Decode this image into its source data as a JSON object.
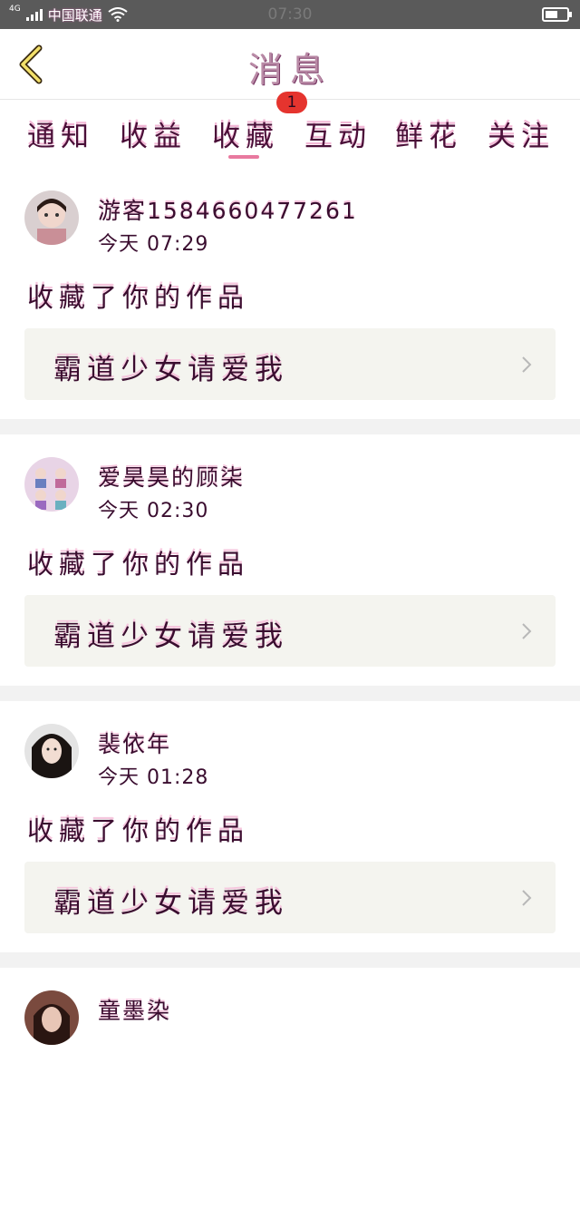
{
  "status_bar": {
    "network": "4G",
    "carrier": "中国联通",
    "time": "07:30",
    "battery_level": 0.6
  },
  "header": {
    "title": "消息"
  },
  "tabs": [
    {
      "label": "通知"
    },
    {
      "label": "收益"
    },
    {
      "label": "收藏",
      "active": true,
      "badge": "1"
    },
    {
      "label": "互动"
    },
    {
      "label": "鲜花"
    },
    {
      "label": "关注"
    }
  ],
  "feed": [
    {
      "username": "游客1584660477261",
      "time": "今天 07:29",
      "action": "收藏了你的作品",
      "work_title": "霸道少女请爱我"
    },
    {
      "username": "爱昊昊的顾柒",
      "time": "今天 02:30",
      "action": "收藏了你的作品",
      "work_title": "霸道少女请爱我"
    },
    {
      "username": "裴依年",
      "time": "今天 01:28",
      "action": "收藏了你的作品",
      "work_title": "霸道少女请爱我"
    },
    {
      "username": "童墨染"
    }
  ],
  "colors": {
    "accent_indicator": "#e8799f",
    "badge": "#e5342e",
    "card_box": "#f4f4ef",
    "separator": "#f2f2f2"
  }
}
